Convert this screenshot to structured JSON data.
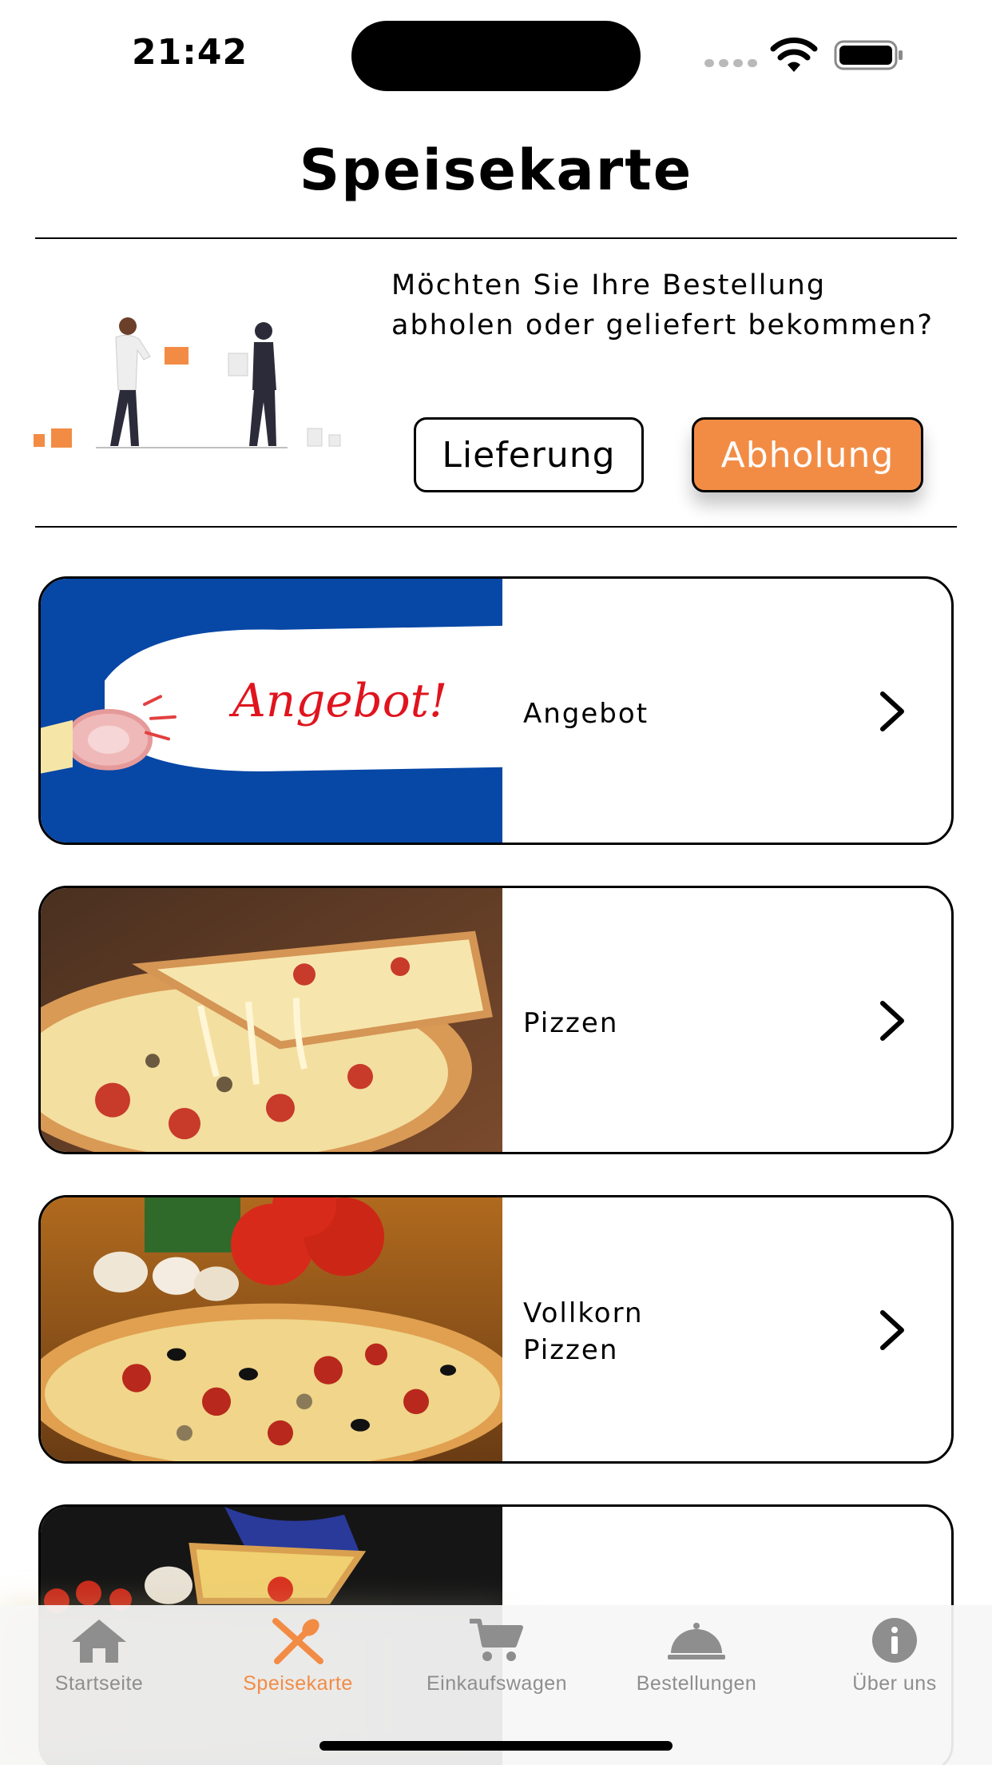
{
  "status_bar": {
    "time": "21:42"
  },
  "header": {
    "title": "Speisekarte"
  },
  "order_mode": {
    "question": "Möchten Sie Ihre Bestellung abholen oder geliefert bekommen?",
    "delivery_label": "Lieferung",
    "pickup_label": "Abholung",
    "selected": "Abholung"
  },
  "categories": [
    {
      "label": "Angebot",
      "banner_text": "Angebot!"
    },
    {
      "label": "Pizzen"
    },
    {
      "label": "Vollkorn Pizzen"
    },
    {
      "label": ""
    }
  ],
  "tabbar": {
    "tabs": [
      {
        "label": "Startseite",
        "icon": "home-icon"
      },
      {
        "label": "Speisekarte",
        "icon": "fork-spoon-icon",
        "active": true
      },
      {
        "label": "Einkaufswagen",
        "icon": "cart-icon"
      },
      {
        "label": "Bestellungen",
        "icon": "cloche-icon"
      },
      {
        "label": "Über uns",
        "icon": "info-icon"
      }
    ]
  },
  "colors": {
    "accent": "#f28c45",
    "banner_blue": "#0747a6",
    "inactive_tab": "#8e8e8e"
  }
}
